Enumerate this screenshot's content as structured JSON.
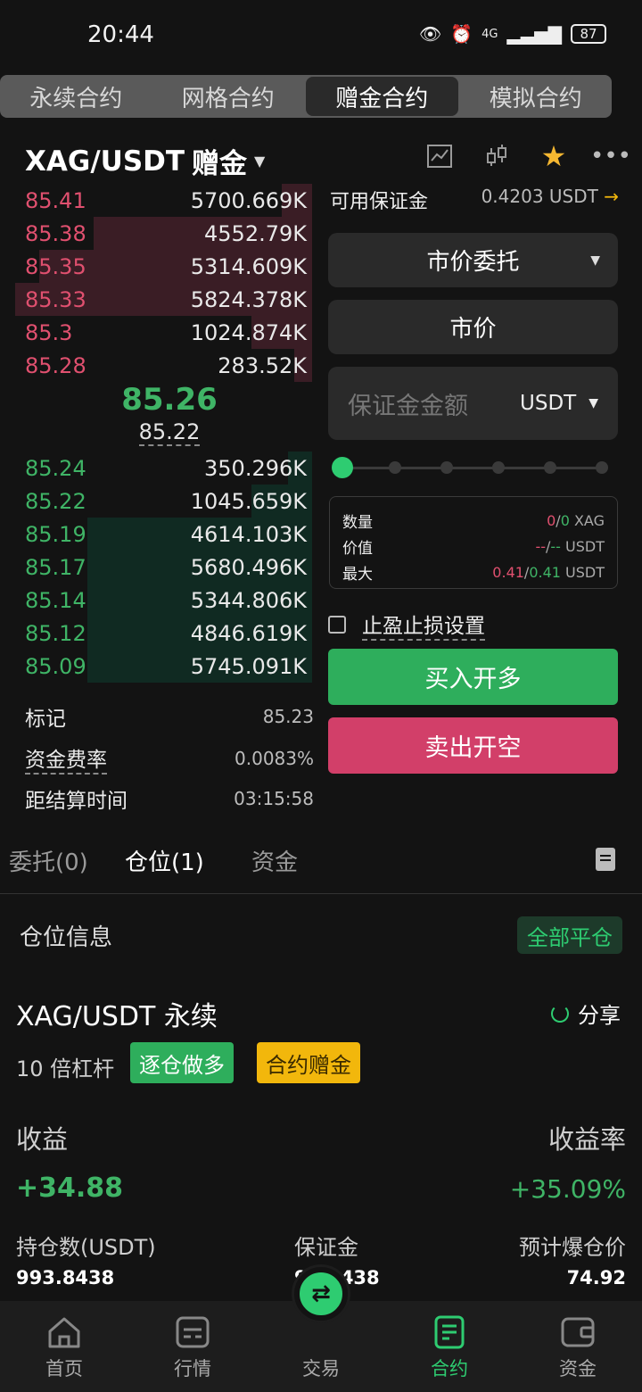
{
  "status": {
    "time": "20:44",
    "network": "4G",
    "battery": "87"
  },
  "tabs": [
    "永续合约",
    "网格合约",
    "赠金合约",
    "模拟合约"
  ],
  "header": {
    "pair": "XAG/USDT",
    "type": "赠金"
  },
  "orderbook": {
    "asks": [
      {
        "price": "85.41",
        "qty": "5700.669K",
        "depth": 0.1
      },
      {
        "price": "85.38",
        "qty": "4552.79K",
        "depth": 0.72
      },
      {
        "price": "85.35",
        "qty": "5314.609K",
        "depth": 0.9
      },
      {
        "price": "85.33",
        "qty": "5824.378K",
        "depth": 0.98
      },
      {
        "price": "85.3",
        "qty": "1024.874K",
        "depth": 0.2
      },
      {
        "price": "85.28",
        "qty": "283.52K",
        "depth": 0.06
      }
    ],
    "last_price": "85.26",
    "mark_price": "85.22",
    "bids": [
      {
        "price": "85.24",
        "qty": "350.296K",
        "depth": 0.08
      },
      {
        "price": "85.22",
        "qty": "1045.659K",
        "depth": 0.2
      },
      {
        "price": "85.19",
        "qty": "4614.103K",
        "depth": 0.74
      },
      {
        "price": "85.17",
        "qty": "5680.496K",
        "depth": 0.74
      },
      {
        "price": "85.14",
        "qty": "5344.806K",
        "depth": 0.74
      },
      {
        "price": "85.12",
        "qty": "4846.619K",
        "depth": 0.74
      },
      {
        "price": "85.09",
        "qty": "5745.091K",
        "depth": 0.74
      }
    ]
  },
  "info": {
    "mark_label": "标记",
    "mark_value": "85.23",
    "funding_label": "资金费率",
    "funding_value": "0.0083%",
    "settle_label": "距结算时间",
    "settle_value": "03:15:58"
  },
  "form": {
    "available_label": "可用保证金",
    "available_value": "0.4203 USDT",
    "order_type": "市价委托",
    "price_mode": "市价",
    "margin_placeholder": "保证金金额",
    "margin_unit": "USDT",
    "slider_level": 0,
    "qty_label": "数量",
    "qty_a": "0",
    "qty_b": "0",
    "qty_unit": "XAG",
    "value_label": "价值",
    "value_a": "--",
    "value_b": "--",
    "value_unit": "USDT",
    "max_label": "最大",
    "max_a": "0.41",
    "max_b": "0.41",
    "max_unit": "USDT",
    "slash": "/",
    "tpsl_label": "止盈止损设置",
    "buy_label": "买入开多",
    "sell_label": "卖出开空"
  },
  "subtabs": [
    "委托(0)",
    "仓位(1)",
    "资金"
  ],
  "position": {
    "section_title": "仓位信息",
    "close_all": "全部平仓",
    "title": "XAG/USDT 永续",
    "share": "分享",
    "leverage": "10 倍杠杆",
    "badge_side": "逐仓做多",
    "badge_bonus": "合约赠金",
    "pnl_label": "收益",
    "pnl_rate_label": "收益率",
    "pnl": "+34.88",
    "pnl_rate": "+35.09%",
    "size_label": "持仓数(USDT)",
    "margin_label": "保证金",
    "liq_label": "预计爆仓价",
    "size_value": "993.8438",
    "margin_value": "99.3438",
    "liq_value": "74.92"
  },
  "nav": [
    "首页",
    "行情",
    "交易",
    "合约",
    "资金"
  ],
  "colors": {
    "green": "#2eae5c",
    "red": "#d23f69",
    "accent": "#2ecc71",
    "bonus": "#f2b70c"
  }
}
